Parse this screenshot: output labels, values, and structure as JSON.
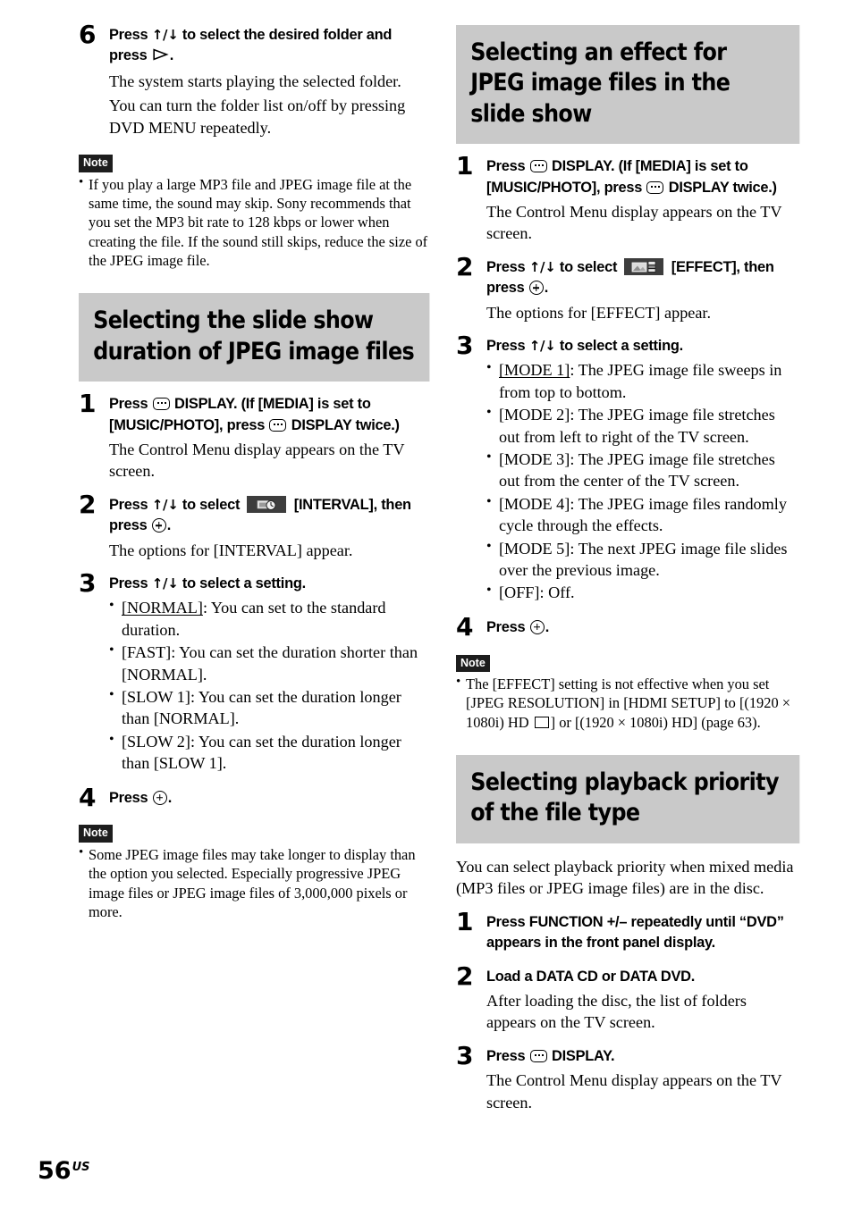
{
  "page": {
    "number": "56",
    "region_suffix": "US"
  },
  "left_column": {
    "step6": {
      "num": "6",
      "title_a": "Press ",
      "title_arrows": "↑/↓",
      "title_b": " to select the desired folder and press ",
      "title_c": ".",
      "desc1": "The system starts playing the selected folder.",
      "desc2": "You can turn the folder list on/off by pressing DVD MENU repeatedly."
    },
    "note1": {
      "badge": "Note",
      "items": [
        "If you play a large MP3 file and JPEG image file at the same time, the sound may skip. Sony recommends that you set the MP3 bit rate to 128 kbps or lower when creating the file. If the sound still skips, reduce the size of the JPEG image file."
      ]
    },
    "heading": "Selecting the slide show duration of JPEG image files",
    "step1": {
      "num": "1",
      "title_a": "Press ",
      "title_b": " DISPLAY. (If [MEDIA] is set to [MUSIC/PHOTO], press ",
      "title_c": " DISPLAY twice.)",
      "desc": "The Control Menu display appears on the TV screen."
    },
    "step2": {
      "num": "2",
      "title_a": "Press ",
      "title_arrows": "↑/↓",
      "title_b": " to select ",
      "title_c": " [INTERVAL], then press ",
      "title_d": ".",
      "chip_icon": "interval-icon",
      "desc": "The options for [INTERVAL] appear."
    },
    "step3": {
      "num": "3",
      "title_a": "Press ",
      "title_arrows": "↑/↓",
      "title_b": " to select a setting.",
      "options": [
        {
          "label": "[NORMAL]",
          "underline": true,
          "text": ": You can set to the standard duration."
        },
        {
          "label": "[FAST]",
          "underline": false,
          "text": ": You can set the duration shorter than [NORMAL]."
        },
        {
          "label": "[SLOW 1]",
          "underline": false,
          "text": ": You can set the duration longer than [NORMAL]."
        },
        {
          "label": "[SLOW 2]",
          "underline": false,
          "text": ": You can set the duration longer than [SLOW 1]."
        }
      ]
    },
    "step4": {
      "num": "4",
      "title_a": "Press ",
      "title_b": "."
    },
    "note2": {
      "badge": "Note",
      "items": [
        "Some JPEG image files may take longer to display than the option you selected. Especially progressive JPEG image files or JPEG image files of 3,000,000 pixels or more."
      ]
    }
  },
  "right_column": {
    "heading1": "Selecting an effect for JPEG image files in the slide show",
    "step1": {
      "num": "1",
      "title_a": "Press ",
      "title_b": " DISPLAY. (If [MEDIA] is set to [MUSIC/PHOTO], press ",
      "title_c": " DISPLAY twice.)",
      "desc": "The Control Menu display appears on the TV screen."
    },
    "step2": {
      "num": "2",
      "title_a": "Press ",
      "title_arrows": "↑/↓",
      "title_b": " to select ",
      "title_c": " [EFFECT], then press ",
      "title_d": ".",
      "chip_icon": "effect-icon",
      "desc": "The options for [EFFECT] appear."
    },
    "step3": {
      "num": "3",
      "title_a": "Press ",
      "title_arrows": "↑/↓",
      "title_b": " to select a setting.",
      "options": [
        {
          "label": "[MODE 1]",
          "underline": true,
          "text": ": The JPEG image file sweeps in from top to bottom."
        },
        {
          "label": "[MODE 2]",
          "underline": false,
          "text": ": The JPEG image file stretches out from left to right of the TV screen."
        },
        {
          "label": "[MODE 3]",
          "underline": false,
          "text": ": The JPEG image file stretches out from the center of the TV screen."
        },
        {
          "label": "[MODE 4]",
          "underline": false,
          "text": ": The JPEG image files randomly cycle through the effects."
        },
        {
          "label": "[MODE 5]",
          "underline": false,
          "text": ": The next JPEG image file slides over the previous image."
        },
        {
          "label": "[OFF]",
          "underline": false,
          "text": ": Off."
        }
      ]
    },
    "step4": {
      "num": "4",
      "title_a": "Press ",
      "title_b": "."
    },
    "note1": {
      "badge": "Note",
      "item_a": "The [EFFECT] setting is not effective when you set [JPEG RESOLUTION] in [HDMI SETUP] to [(1920 × 1080i) HD ",
      "item_b": "] or [(1920 × 1080i) HD] (page 63)."
    },
    "heading2": "Selecting playback priority of the file type",
    "intro": "You can select playback priority when mixed media (MP3 files or JPEG image files) are in the disc.",
    "step_a": {
      "num": "1",
      "title": "Press FUNCTION +/– repeatedly until “DVD” appears in the front panel display."
    },
    "step_b": {
      "num": "2",
      "title": "Load a DATA CD or DATA DVD.",
      "desc": "After loading the disc, the list of folders appears on the TV screen."
    },
    "step_c": {
      "num": "3",
      "title_a": "Press ",
      "title_b": " DISPLAY.",
      "desc": "The Control Menu display appears on the TV screen."
    }
  },
  "colors": {
    "heading_bar": "#c9c9c9",
    "note_badge": "#1d1d1d",
    "chip": "#3d3d3d"
  }
}
